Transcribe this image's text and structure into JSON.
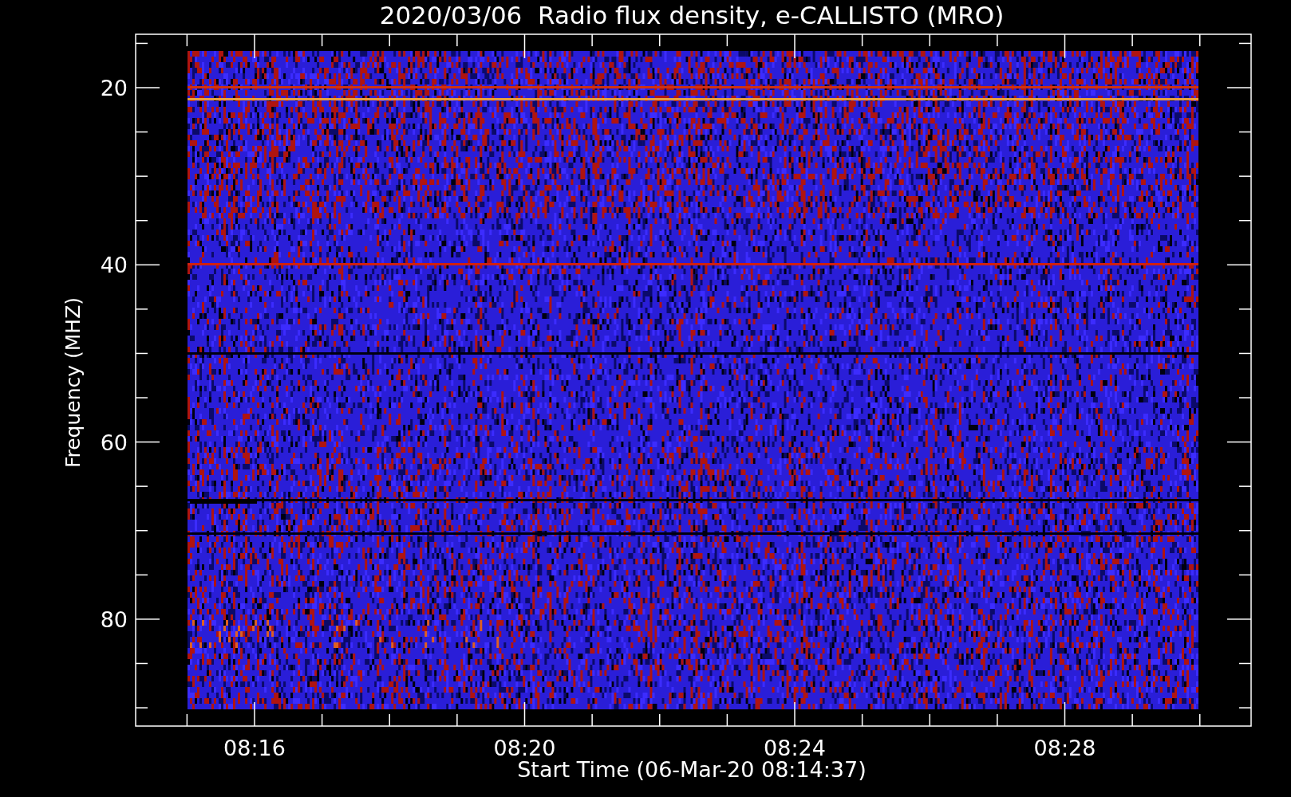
{
  "title": "2020/03/06  Radio flux density, e-CALLISTO (MRO)",
  "y_axis": {
    "label": "Frequency (MHZ)",
    "ticks": [
      "20",
      "40",
      "60",
      "80"
    ]
  },
  "x_axis": {
    "label": "Start Time (06-Mar-20 08:14:37)",
    "ticks": [
      "08:16",
      "08:20",
      "08:24",
      "08:28"
    ]
  }
}
